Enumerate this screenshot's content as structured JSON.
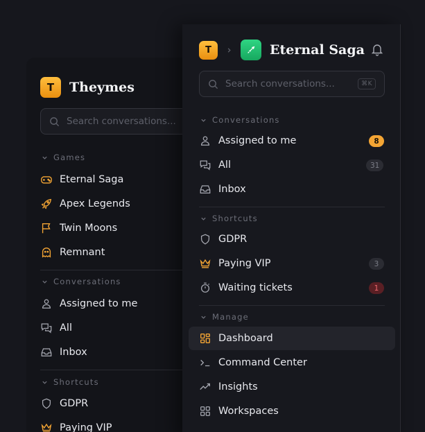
{
  "back_panel": {
    "logo_letter": "T",
    "title": "Theymes",
    "search_placeholder": "Search conversations...",
    "sections": {
      "games": "Games",
      "conversations": "Conversations",
      "shortcuts": "Shortcuts"
    },
    "games": [
      "Eternal Saga",
      "Apex Legends",
      "Twin Moons",
      "Remnant"
    ],
    "conversations": [
      "Assigned to me",
      "All",
      "Inbox"
    ],
    "shortcuts": [
      "GDPR",
      "Paying VIP"
    ]
  },
  "front_panel": {
    "workspace_letter": "T",
    "game_title": "Eternal Saga",
    "search_placeholder": "Search conversations...",
    "search_shortcut": "⌘K",
    "sections": {
      "conversations": "Conversations",
      "shortcuts": "Shortcuts",
      "manage": "Manage"
    },
    "conversations": [
      {
        "label": "Assigned to me",
        "badge": "8"
      },
      {
        "label": "All",
        "badge": "31"
      },
      {
        "label": "Inbox",
        "badge": ""
      }
    ],
    "shortcuts": [
      {
        "label": "GDPR",
        "badge": ""
      },
      {
        "label": "Paying VIP",
        "badge": "3"
      },
      {
        "label": "Waiting tickets",
        "badge": "1"
      }
    ],
    "manage": [
      "Dashboard",
      "Command Center",
      "Insights",
      "Workspaces"
    ]
  },
  "colors": {
    "accent_orange": "#f4a534",
    "game_icon_green": "#22c473",
    "badge_red": "#f06a70"
  }
}
